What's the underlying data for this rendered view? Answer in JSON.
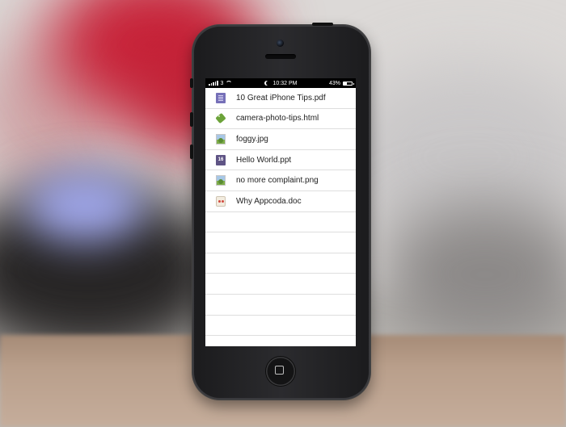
{
  "statusbar": {
    "carrier": "3",
    "time": "10:32 PM",
    "battery_percent": "43%",
    "battery_level": 0.43
  },
  "files": [
    {
      "name": "10 Great iPhone Tips.pdf",
      "icon": "pdf-icon"
    },
    {
      "name": "camera-photo-tips.html",
      "icon": "html-tag-icon"
    },
    {
      "name": "foggy.jpg",
      "icon": "image-icon"
    },
    {
      "name": "Hello World.ppt",
      "icon": "ppt-calendar-icon",
      "badge": "16"
    },
    {
      "name": "no more complaint.png",
      "icon": "image-icon"
    },
    {
      "name": "Why Appcoda.doc",
      "icon": "doc-icon"
    }
  ],
  "empty_rows": 6,
  "colors": {
    "pdf_icon": "#7670b8",
    "html_icon": "#6ca33a",
    "ppt_icon": "#5f5485",
    "row_divider": "#dedede"
  }
}
